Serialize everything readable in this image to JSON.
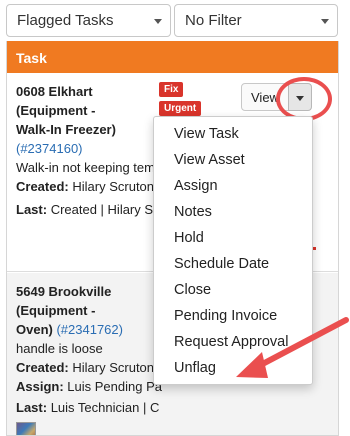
{
  "filters": {
    "primary": "Flagged Tasks",
    "secondary": "No Filter"
  },
  "table": {
    "header": "Task"
  },
  "tasks": [
    {
      "title_line1": "0608 Elkhart",
      "title_line2": "(Equipment -",
      "title_line3": "Walk-In Freezer)",
      "link": "(#2374160)",
      "description": "Walk-in not keeping tem",
      "created_label": "Created:",
      "created_value": "Hilary Scruton",
      "last_label": "Last:",
      "last_value": "Created | Hilary Sc",
      "badges": [
        "Fix",
        "Urgent"
      ],
      "view_label": "View"
    },
    {
      "title_line1": "5649 Brookville",
      "title_line2": "(Equipment -",
      "title_line3": "Oven)",
      "link": "(#2341762)",
      "description": "handle is loose",
      "created_label": "Created:",
      "created_value": "Hilary Scruton",
      "assign_label": "Assign:",
      "assign_value": "Luis Pending Pa",
      "last_label": "Last:",
      "last_value": "Luis Technician | C"
    }
  ],
  "menu": {
    "items": [
      "View Task",
      "View Asset",
      "Assign",
      "Notes",
      "Hold",
      "Schedule Date",
      "Close",
      "Pending Invoice",
      "Request Approval",
      "Unflag"
    ]
  },
  "colors": {
    "header_orange": "#f07a21",
    "badge_red": "#d9342b",
    "annotation_red": "#ea4f4f",
    "link_blue": "#2a6db3"
  }
}
